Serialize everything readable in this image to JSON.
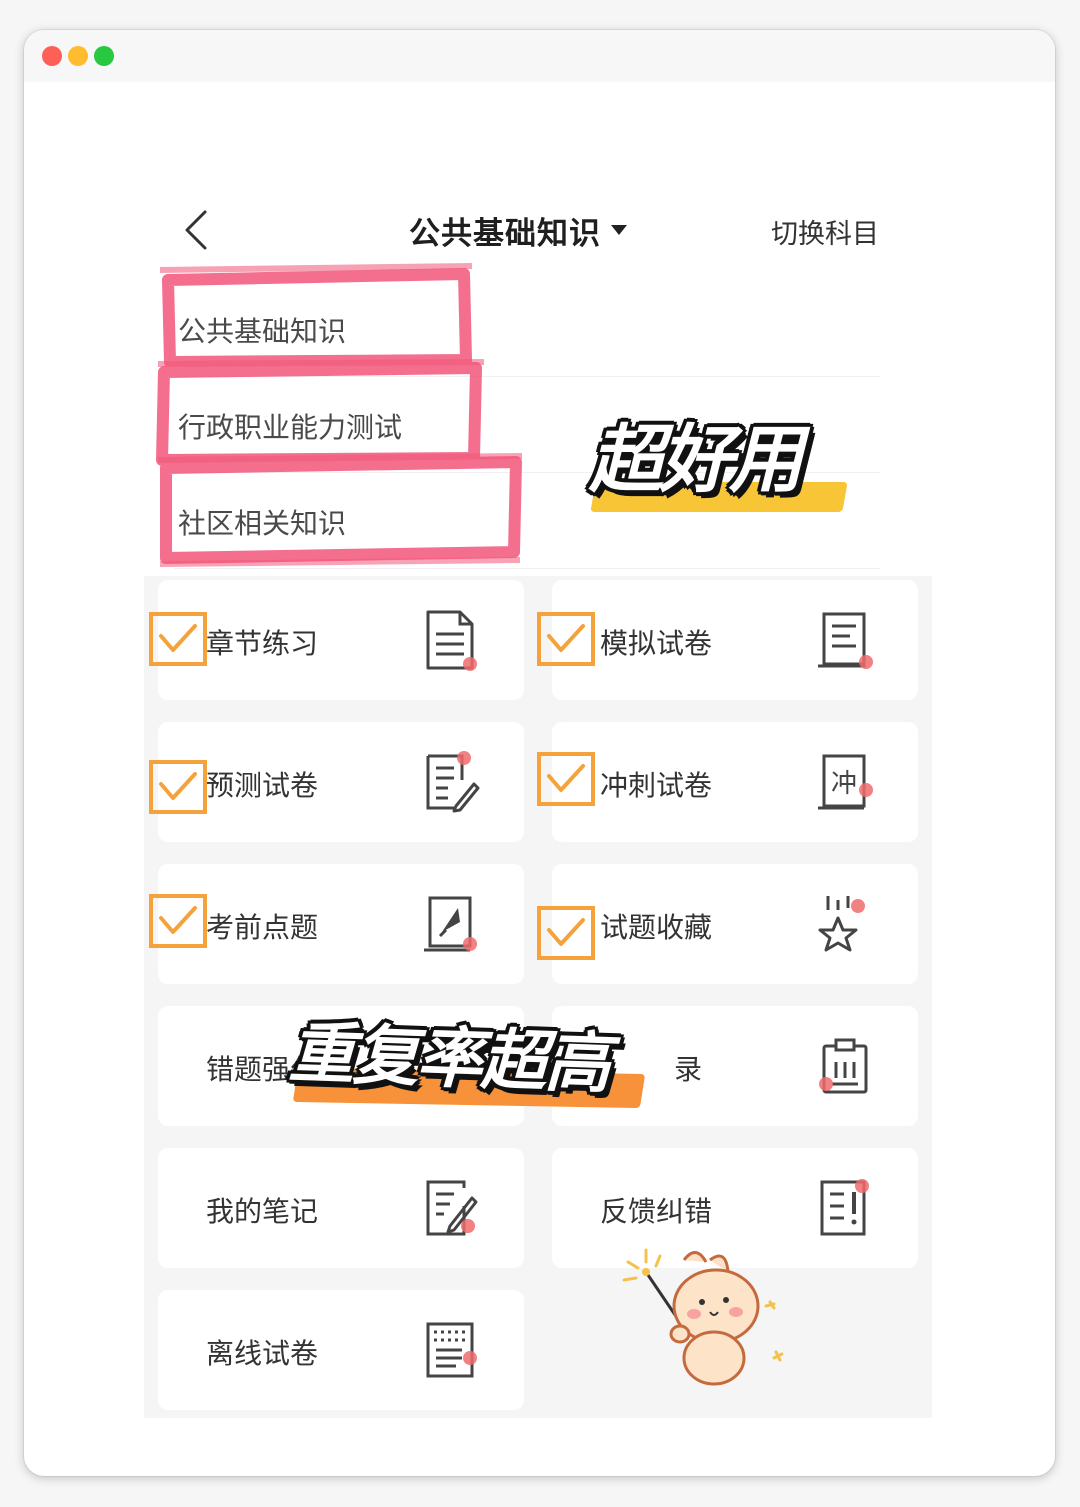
{
  "nav": {
    "title": "公共基础知识",
    "switch_label": "切换科目"
  },
  "subjects": [
    {
      "label": "公共基础知识"
    },
    {
      "label": "行政职业能力测试"
    },
    {
      "label": "社区相关知识"
    }
  ],
  "overlays": {
    "top_sticker": "超好用",
    "middle_sticker": "重复率超高"
  },
  "cards": [
    {
      "label": "章节练习",
      "icon": "document-icon",
      "checked": true
    },
    {
      "label": "模拟试卷",
      "icon": "exam-paper-icon",
      "checked": true
    },
    {
      "label": "预测试卷",
      "icon": "edit-list-icon",
      "checked": true
    },
    {
      "label": "冲刺试卷",
      "icon": "sprint-paper-icon",
      "checked": true
    },
    {
      "label": "考前点题",
      "icon": "rocket-icon",
      "checked": true
    },
    {
      "label": "试题收藏",
      "icon": "star-icon",
      "checked": true
    },
    {
      "label": "错题强化",
      "suffix": "录",
      "icon": "clipboard-icon",
      "checked": false
    },
    {
      "label": "我的笔记",
      "icon": "note-pen-icon",
      "checked": false
    },
    {
      "label": "反馈纠错",
      "icon": "feedback-icon",
      "checked": false
    },
    {
      "label": "离线试卷",
      "icon": "offline-paper-icon",
      "checked": false
    }
  ],
  "colors": {
    "highlight_pink": "#f2567a",
    "check_orange": "#f4a33c",
    "sticker_yellow": "#f7c536",
    "sticker_orange": "#f7923a",
    "icon_red_dot": "#f06b6b"
  }
}
